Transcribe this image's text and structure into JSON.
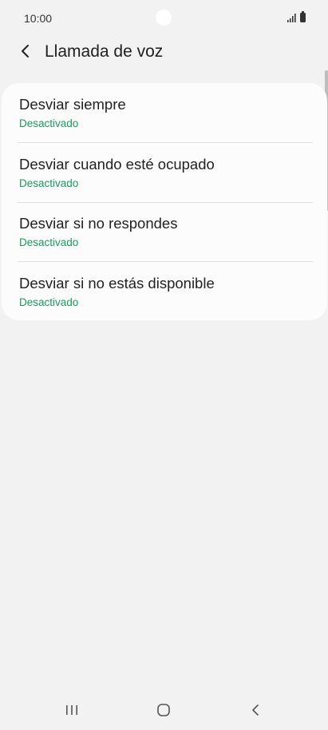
{
  "status_bar": {
    "time": "10:00"
  },
  "header": {
    "title": "Llamada de voz",
    "back_icon": "chevron-left-icon"
  },
  "list": {
    "items": [
      {
        "title": "Desviar siempre",
        "status": "Desactivado"
      },
      {
        "title": "Desviar cuando esté ocupado",
        "status": "Desactivado"
      },
      {
        "title": "Desviar si no respondes",
        "status": "Desactivado"
      },
      {
        "title": "Desviar si no estás disponible",
        "status": "Desactivado"
      }
    ]
  },
  "navigation": {
    "recents_icon": "recent-apps-icon",
    "home_icon": "home-icon",
    "back_icon": "back-icon"
  },
  "colors": {
    "background": "#f2f2f2",
    "card": "#fcfcfc",
    "status_text": "#1a9c5e",
    "primary_text": "#222222"
  }
}
